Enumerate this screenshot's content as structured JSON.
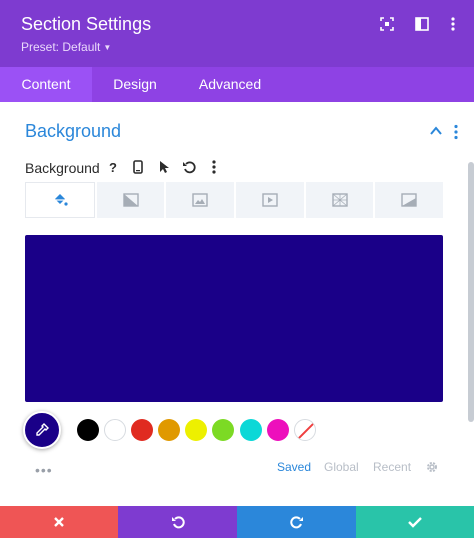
{
  "header": {
    "title": "Section Settings",
    "preset": "Preset: Default",
    "icons": [
      "expand-icon",
      "sidebar-icon",
      "more-vertical-icon"
    ]
  },
  "tabs": [
    {
      "label": "Content",
      "active": true
    },
    {
      "label": "Design",
      "active": false
    },
    {
      "label": "Advanced",
      "active": false
    }
  ],
  "section": {
    "title": "Background",
    "field_label": "Background",
    "help_glyph": "?"
  },
  "background_types": [
    "color",
    "gradient",
    "image",
    "video",
    "pattern",
    "mask"
  ],
  "selected_color": "#1a0088",
  "swatches": [
    "#000000",
    "#ffffff",
    "#e02b20",
    "#e09900",
    "#edf000",
    "#7cda24",
    "#0bd8d7",
    "#ed0fbc",
    "none"
  ],
  "palette_tabs": [
    {
      "label": "Saved",
      "active": true
    },
    {
      "label": "Global",
      "active": false
    },
    {
      "label": "Recent",
      "active": false
    }
  ],
  "colors": {
    "header": "#7e3bd0",
    "tabs": "#8e42e4",
    "active_tab": "#9b51f5",
    "accent_blue": "#2b87da",
    "footer_cancel": "#ef5555",
    "footer_undo": "#7e3bd0",
    "footer_redo": "#2b87da",
    "footer_save": "#29c4a9"
  },
  "footer": [
    "cancel-icon",
    "undo-icon",
    "redo-icon",
    "save-icon"
  ]
}
